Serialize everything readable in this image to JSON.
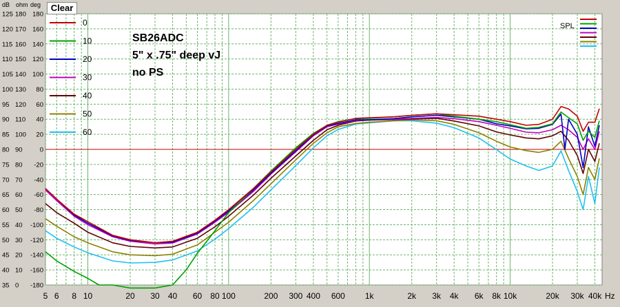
{
  "toolbar": {
    "clear_label": "Clear"
  },
  "chart_data": {
    "type": "line",
    "title": "",
    "xlabel": "Hz",
    "xscale": "log",
    "xlim": [
      5,
      45000
    ],
    "grid": true,
    "axis_unit_headers": [
      "dB",
      "ohm",
      "deg"
    ],
    "y_axes": {
      "dB": {
        "ticks": [
          125,
          120,
          115,
          110,
          105,
          100,
          95,
          90,
          85,
          80,
          75,
          70,
          65,
          60,
          55,
          50,
          45,
          40,
          35
        ],
        "lim": [
          35,
          125
        ]
      },
      "ohm": {
        "ticks": [
          180,
          170,
          160,
          150,
          140,
          130,
          120,
          110,
          100,
          90,
          80,
          70,
          60,
          50,
          40,
          30,
          20,
          10,
          0
        ],
        "lim": [
          0,
          180
        ]
      },
      "deg": {
        "ticks": [
          180,
          160,
          140,
          120,
          100,
          80,
          60,
          40,
          20,
          0,
          -20,
          -40,
          -60,
          -80,
          -100,
          -120,
          -140,
          -160,
          -180
        ],
        "lim": [
          -180,
          180
        ]
      }
    },
    "x_tick_labels": [
      {
        "v": 5,
        "t": "5"
      },
      {
        "v": 6,
        "t": "6"
      },
      {
        "v": 8,
        "t": "8"
      },
      {
        "v": 10,
        "t": "10"
      },
      {
        "v": 20,
        "t": "20"
      },
      {
        "v": 30,
        "t": "30"
      },
      {
        "v": 40,
        "t": "40"
      },
      {
        "v": 60,
        "t": "60"
      },
      {
        "v": 80,
        "t": "80"
      },
      {
        "v": 100,
        "t": "100"
      },
      {
        "v": 200,
        "t": "200"
      },
      {
        "v": 300,
        "t": "300"
      },
      {
        "v": 400,
        "t": "400"
      },
      {
        "v": 600,
        "t": "600"
      },
      {
        "v": 1000,
        "t": "1k"
      },
      {
        "v": 2000,
        "t": "2k"
      },
      {
        "v": 3000,
        "t": "3k"
      },
      {
        "v": 4000,
        "t": "4k"
      },
      {
        "v": 6000,
        "t": "6k"
      },
      {
        "v": 8000,
        "t": "8k"
      },
      {
        "v": 10000,
        "t": "10k"
      },
      {
        "v": 20000,
        "t": "20k"
      },
      {
        "v": 30000,
        "t": "30k"
      },
      {
        "v": 40000,
        "t": "40k"
      }
    ],
    "reference_line": {
      "db": 80,
      "color": "#c00000"
    },
    "annotations": [
      "SB26ADC",
      "5\" x .75\" deep vJ",
      "no PS"
    ],
    "spl_label": "SPL",
    "colors": {
      "background": "#ffffff",
      "frame": "#d4d0c8",
      "grid": "#6db36d"
    },
    "series": [
      {
        "name": "0",
        "color": "#c00000",
        "points": [
          [
            5,
            67
          ],
          [
            6,
            63.5
          ],
          [
            8,
            58.5
          ],
          [
            10,
            56
          ],
          [
            15,
            51.5
          ],
          [
            20,
            50
          ],
          [
            30,
            49
          ],
          [
            40,
            49.5
          ],
          [
            60,
            52.5
          ],
          [
            80,
            56.5
          ],
          [
            100,
            60
          ],
          [
            150,
            67
          ],
          [
            200,
            72.5
          ],
          [
            300,
            80
          ],
          [
            400,
            85
          ],
          [
            500,
            88
          ],
          [
            600,
            89
          ],
          [
            800,
            90.3
          ],
          [
            1000,
            90.5
          ],
          [
            1500,
            90.8
          ],
          [
            2000,
            91.3
          ],
          [
            3000,
            91.8
          ],
          [
            4000,
            91.5
          ],
          [
            6000,
            91
          ],
          [
            8000,
            90
          ],
          [
            10000,
            89.2
          ],
          [
            13000,
            88
          ],
          [
            16000,
            88.3
          ],
          [
            20000,
            90
          ],
          [
            23000,
            94.2
          ],
          [
            26000,
            93.4
          ],
          [
            30000,
            91
          ],
          [
            33000,
            86
          ],
          [
            36000,
            89
          ],
          [
            40000,
            89
          ],
          [
            43000,
            93.5
          ]
        ]
      },
      {
        "name": "10",
        "color": "#00a000",
        "points": [
          [
            5,
            46
          ],
          [
            6,
            43
          ],
          [
            8,
            39.5
          ],
          [
            10,
            37.2
          ],
          [
            12,
            35
          ],
          [
            15,
            35
          ],
          [
            20,
            34
          ],
          [
            30,
            34
          ],
          [
            40,
            35
          ],
          [
            50,
            40
          ],
          [
            60,
            45.5
          ],
          [
            80,
            53
          ],
          [
            100,
            59
          ],
          [
            150,
            67
          ],
          [
            200,
            72.8
          ],
          [
            300,
            80.5
          ],
          [
            400,
            85.3
          ],
          [
            500,
            88
          ],
          [
            600,
            89.2
          ],
          [
            800,
            90.2
          ],
          [
            1000,
            90.3
          ],
          [
            1500,
            90.8
          ],
          [
            2000,
            91.3
          ],
          [
            3000,
            91.8
          ],
          [
            4000,
            91
          ],
          [
            6000,
            90
          ],
          [
            8000,
            89.2
          ],
          [
            10000,
            88.2
          ],
          [
            13000,
            87
          ],
          [
            16000,
            87.3
          ],
          [
            20000,
            88.5
          ],
          [
            23000,
            92.4
          ],
          [
            26000,
            90.5
          ],
          [
            30000,
            88.5
          ],
          [
            33000,
            83
          ],
          [
            36000,
            86
          ],
          [
            40000,
            84
          ],
          [
            43000,
            89.5
          ]
        ]
      },
      {
        "name": "20",
        "color": "#0000c0",
        "points": [
          [
            5,
            67
          ],
          [
            6,
            63.5
          ],
          [
            8,
            58.2
          ],
          [
            10,
            55.5
          ],
          [
            15,
            51.3
          ],
          [
            20,
            49.8
          ],
          [
            30,
            49
          ],
          [
            40,
            49.2
          ],
          [
            60,
            52.2
          ],
          [
            80,
            56.2
          ],
          [
            100,
            59.5
          ],
          [
            150,
            66.5
          ],
          [
            200,
            72.1
          ],
          [
            300,
            79.5
          ],
          [
            400,
            84.8
          ],
          [
            500,
            87.8
          ],
          [
            600,
            88.6
          ],
          [
            800,
            89.8
          ],
          [
            1000,
            89.8
          ],
          [
            1500,
            90.2
          ],
          [
            2000,
            90.8
          ],
          [
            3000,
            91.3
          ],
          [
            4000,
            90.8
          ],
          [
            6000,
            90
          ],
          [
            8000,
            88.5
          ],
          [
            10000,
            87.8
          ],
          [
            13000,
            86.8
          ],
          [
            16000,
            87
          ],
          [
            20000,
            88.3
          ],
          [
            23000,
            91.7
          ],
          [
            24500,
            80
          ],
          [
            26000,
            90
          ],
          [
            30000,
            85
          ],
          [
            33000,
            74
          ],
          [
            36000,
            87.5
          ],
          [
            40000,
            81
          ],
          [
            43000,
            88
          ]
        ]
      },
      {
        "name": "30",
        "color": "#c000c0",
        "points": [
          [
            5,
            66.5
          ],
          [
            6,
            63
          ],
          [
            8,
            57.8
          ],
          [
            10,
            55
          ],
          [
            15,
            51
          ],
          [
            20,
            49.5
          ],
          [
            30,
            48.6
          ],
          [
            40,
            48.9
          ],
          [
            60,
            51.9
          ],
          [
            80,
            55.8
          ],
          [
            100,
            59.1
          ],
          [
            150,
            66
          ],
          [
            200,
            71.8
          ],
          [
            300,
            79.2
          ],
          [
            400,
            84.5
          ],
          [
            500,
            87.5
          ],
          [
            600,
            88.4
          ],
          [
            800,
            89.6
          ],
          [
            1000,
            89.8
          ],
          [
            1500,
            90
          ],
          [
            2000,
            90.3
          ],
          [
            3000,
            90.6
          ],
          [
            4000,
            90.2
          ],
          [
            6000,
            89.2
          ],
          [
            8000,
            88
          ],
          [
            10000,
            87
          ],
          [
            13000,
            85.7
          ],
          [
            16000,
            85.5
          ],
          [
            20000,
            86.5
          ],
          [
            23000,
            88
          ],
          [
            26000,
            86.5
          ],
          [
            30000,
            84
          ],
          [
            33000,
            80
          ],
          [
            36000,
            83.5
          ],
          [
            40000,
            80
          ],
          [
            43000,
            86
          ]
        ]
      },
      {
        "name": "40",
        "color": "#600000",
        "points": [
          [
            5,
            62
          ],
          [
            6,
            59
          ],
          [
            8,
            55.5
          ],
          [
            10,
            52.5
          ],
          [
            15,
            49
          ],
          [
            20,
            47.8
          ],
          [
            30,
            47.3
          ],
          [
            40,
            47.6
          ],
          [
            60,
            50.5
          ],
          [
            80,
            54.3
          ],
          [
            100,
            57.8
          ],
          [
            150,
            64.8
          ],
          [
            200,
            70.4
          ],
          [
            300,
            77.8
          ],
          [
            400,
            83
          ],
          [
            500,
            86.5
          ],
          [
            600,
            88
          ],
          [
            800,
            89.4
          ],
          [
            1000,
            89.7
          ],
          [
            1500,
            89.9
          ],
          [
            2000,
            90.1
          ],
          [
            3000,
            90.3
          ],
          [
            4000,
            89.4
          ],
          [
            6000,
            87.8
          ],
          [
            8000,
            85.8
          ],
          [
            10000,
            84.8
          ],
          [
            13000,
            83.8
          ],
          [
            16000,
            83.5
          ],
          [
            20000,
            84.5
          ],
          [
            23000,
            86
          ],
          [
            26000,
            83
          ],
          [
            30000,
            78
          ],
          [
            33000,
            72
          ],
          [
            36000,
            80
          ],
          [
            40000,
            76
          ],
          [
            43000,
            82
          ]
        ]
      },
      {
        "name": "50",
        "color": "#8c8000",
        "points": [
          [
            5,
            57
          ],
          [
            6,
            54.5
          ],
          [
            8,
            51
          ],
          [
            10,
            49
          ],
          [
            15,
            46
          ],
          [
            20,
            45
          ],
          [
            30,
            44.7
          ],
          [
            40,
            45.2
          ],
          [
            60,
            48.3
          ],
          [
            80,
            52.5
          ],
          [
            100,
            55.8
          ],
          [
            150,
            63
          ],
          [
            200,
            68.6
          ],
          [
            300,
            76.5
          ],
          [
            400,
            82
          ],
          [
            500,
            85.5
          ],
          [
            600,
            87.5
          ],
          [
            800,
            88.6
          ],
          [
            1000,
            89
          ],
          [
            1500,
            89.5
          ],
          [
            2000,
            89.8
          ],
          [
            3000,
            89.5
          ],
          [
            4000,
            88.3
          ],
          [
            6000,
            85.5
          ],
          [
            8000,
            82.7
          ],
          [
            10000,
            80.8
          ],
          [
            13000,
            79.6
          ],
          [
            16000,
            79
          ],
          [
            20000,
            80
          ],
          [
            23000,
            82.7
          ],
          [
            26000,
            77
          ],
          [
            30000,
            71
          ],
          [
            33000,
            65
          ],
          [
            36000,
            74
          ],
          [
            40000,
            70
          ],
          [
            43000,
            77
          ]
        ]
      },
      {
        "name": "60",
        "color": "#20c0f0",
        "points": [
          [
            5,
            53
          ],
          [
            6,
            50.5
          ],
          [
            8,
            47.6
          ],
          [
            10,
            45.7
          ],
          [
            15,
            43
          ],
          [
            20,
            42.3
          ],
          [
            30,
            42.5
          ],
          [
            40,
            43.3
          ],
          [
            60,
            46.3
          ],
          [
            80,
            50.2
          ],
          [
            100,
            53.7
          ],
          [
            150,
            60.8
          ],
          [
            200,
            66.6
          ],
          [
            300,
            74.6
          ],
          [
            400,
            80.5
          ],
          [
            500,
            84.5
          ],
          [
            600,
            86.6
          ],
          [
            800,
            88.4
          ],
          [
            1000,
            88.8
          ],
          [
            1500,
            89.5
          ],
          [
            2000,
            89.5
          ],
          [
            3000,
            88.7
          ],
          [
            4000,
            87.2
          ],
          [
            6000,
            83.8
          ],
          [
            8000,
            79.9
          ],
          [
            10000,
            76.8
          ],
          [
            13000,
            74.5
          ],
          [
            16000,
            73
          ],
          [
            20000,
            74.5
          ],
          [
            23000,
            79.5
          ],
          [
            26000,
            73
          ],
          [
            30000,
            66
          ],
          [
            33000,
            60
          ],
          [
            36000,
            71
          ],
          [
            40000,
            62
          ],
          [
            43000,
            74
          ]
        ]
      }
    ]
  }
}
